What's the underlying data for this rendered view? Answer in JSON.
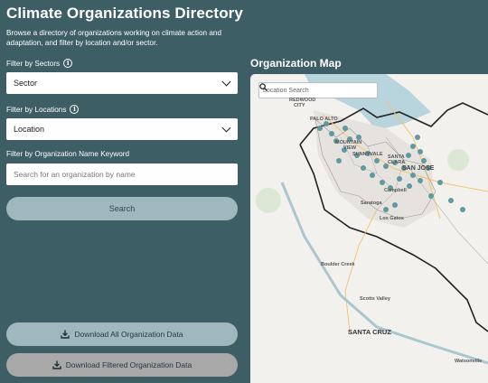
{
  "page": {
    "title": "Climate Organizations Directory",
    "subtitle": "Browse a directory of organizations working on climate action and adaptation, and filter by location and/or sector."
  },
  "filters": {
    "sectors_label": "Filter by Sectors",
    "sectors_value": "Sector",
    "locations_label": "Filter by Locations",
    "locations_value": "Location",
    "keyword_label": "Filter by Organization Name Keyword",
    "keyword_placeholder": "Search for an organization by name",
    "info_glyph": "i"
  },
  "buttons": {
    "search": "Search",
    "download_all": "Download All Organization Data",
    "download_filtered": "Download Filtered Organization Data"
  },
  "map": {
    "title": "Organization Map",
    "search_placeholder": "Location Search",
    "places": {
      "redwood_city_1": "REDWOOD",
      "redwood_city_2": "CITY",
      "palo_alto": "PALO ALTO",
      "mountain_view_1": "MOUNTAIN",
      "mountain_view_2": "VIEW",
      "sunnyvale": "SUNNYVALE",
      "santa_clara_1": "SANTA",
      "santa_clara_2": "CLARA",
      "san_jose": "SAN JOSE",
      "campbell": "Campbell",
      "saratoga": "Saratoga",
      "los_gatos": "Los Gatos",
      "boulder_creek": "Boulder Creek",
      "scotts_valley": "Scotts Valley",
      "santa_cruz": "SANTA CRUZ",
      "watsonville": "Watsonville"
    }
  },
  "colors": {
    "background": "#3e5e66",
    "button": "#9eb8be",
    "button_disabled": "#a8a8a8",
    "marker": "#5f9aa0",
    "water": "#b8d4dc"
  },
  "icons": {
    "search": "search-icon",
    "download": "download-icon",
    "info": "info-icon",
    "chevron": "chevron-down-icon"
  }
}
